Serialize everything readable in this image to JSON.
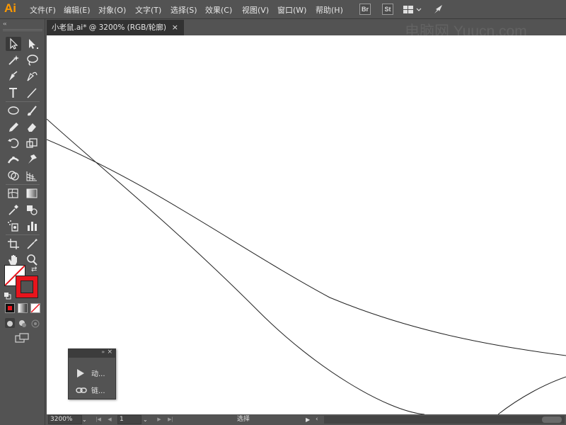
{
  "app": {
    "logo": "Ai",
    "menu": [
      "文件(F)",
      "编辑(E)",
      "对象(O)",
      "文字(T)",
      "选择(S)",
      "效果(C)",
      "视图(V)",
      "窗口(W)",
      "帮助(H)"
    ],
    "bridge_label": "Br",
    "stock_label": "St",
    "accent_color": "#ff9a00"
  },
  "document": {
    "tab_title": "小老鼠.ai* @ 3200% (RGB/轮廓)",
    "close_glyph": "×"
  },
  "watermark": "电脑网 Yuucn.com",
  "toolbar": {
    "collapse_glyph": "‹‹",
    "fill_color": "#ffffff",
    "stroke_color": "#e8141c",
    "tools": [
      "selection-tool",
      "direct-selection-tool",
      "magic-wand-tool",
      "lasso-tool",
      "pen-tool",
      "curvature-tool",
      "type-tool",
      "line-segment-tool",
      "ellipse-tool",
      "paintbrush-tool",
      "pencil-tool",
      "eraser-tool",
      "rotate-tool",
      "scale-tool",
      "width-tool",
      "puppet-warp-tool",
      "shape-builder-tool",
      "perspective-grid-tool",
      "mesh-tool",
      "gradient-tool",
      "eyedropper-tool",
      "blend-tool",
      "symbol-sprayer-tool",
      "column-graph-tool",
      "artboard-tool",
      "slice-tool",
      "hand-tool",
      "zoom-tool"
    ]
  },
  "float_panel": {
    "collapse_glyph": "››",
    "close_glyph": "×",
    "items": [
      {
        "icon": "play-icon",
        "label": "动..."
      },
      {
        "icon": "link-icon",
        "label": "链..."
      }
    ]
  },
  "statusbar": {
    "zoom": "3200%",
    "page": "1",
    "status": "选择",
    "dropdown_glyph": "⌄",
    "first_glyph": "|◀",
    "prev_glyph": "◀",
    "next_glyph": "▶",
    "last_glyph": "▶|",
    "status_arrow": "▶",
    "scroll_left": "‹"
  }
}
